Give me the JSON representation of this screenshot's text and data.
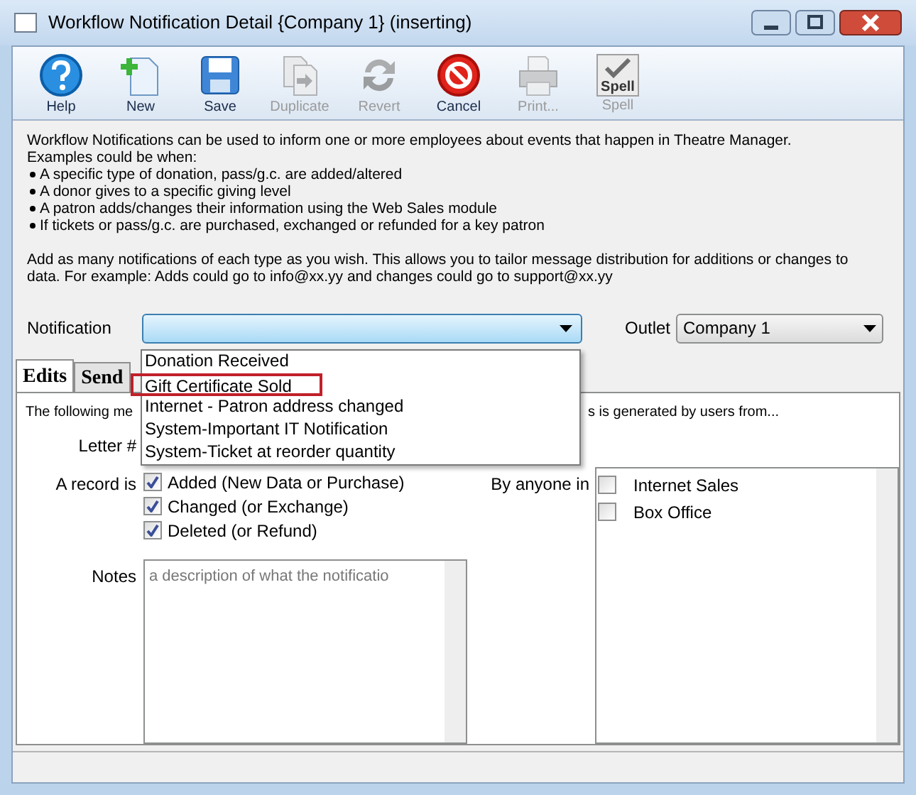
{
  "window": {
    "title": "Workflow Notification Detail {Company 1} (inserting)"
  },
  "toolbar": [
    {
      "label": "Help",
      "kind": "help",
      "disabled": false
    },
    {
      "label": "New",
      "kind": "new",
      "disabled": false
    },
    {
      "label": "Save",
      "kind": "save",
      "disabled": false
    },
    {
      "label": "Duplicate",
      "kind": "duplicate",
      "disabled": true
    },
    {
      "label": "Revert",
      "kind": "revert",
      "disabled": true
    },
    {
      "label": "Cancel",
      "kind": "cancel",
      "disabled": false
    },
    {
      "label": "Print...",
      "kind": "print",
      "disabled": true
    },
    {
      "label": "Spell",
      "kind": "spell",
      "disabled": true,
      "icon_text": "Spell"
    }
  ],
  "info": {
    "intro": [
      "Workflow Notifications can be used to inform one or more employees about events that happen in Theatre Manager.",
      "Examples could be when:"
    ],
    "bullets": [
      "A specific type of donation, pass/g.c. are added/altered",
      "A donor gives to a specific giving level",
      "A patron adds/changes their information using the Web Sales module",
      "If tickets or pass/g.c. are purchased, exchanged or refunded for a key patron"
    ],
    "outro": "Add as many notifications of each type as you wish.  This allows you to tailor message distribution for additions or changes to data.  For example: Adds could go to info@xx.yy and changes could go to support@xx.yy"
  },
  "notification": {
    "label": "Notification",
    "expanded": true,
    "options": [
      {
        "label": "Donation Received",
        "highlighted": false
      },
      {
        "label": "Gift Certificate Sold",
        "highlighted": true
      },
      {
        "label": "Internet - Patron address changed",
        "highlighted": false
      },
      {
        "label": "System-Important IT Notification",
        "highlighted": false
      },
      {
        "label": "System-Ticket at reorder quantity",
        "highlighted": false
      }
    ]
  },
  "outlet": {
    "label": "Outlet",
    "value": "Company 1"
  },
  "tabs": [
    {
      "label": "Edits",
      "selected": true
    },
    {
      "label": "Send",
      "selected": false
    }
  ],
  "panel": {
    "description_left": "The following me",
    "description_right": "s is generated by users from...",
    "letter_label": "Letter #",
    "record_label": "A record is",
    "record_options": [
      {
        "label": "Added (New Data or Purchase)",
        "checked": true
      },
      {
        "label": "Changed (or Exchange)",
        "checked": true
      },
      {
        "label": "Deleted (or Refund)",
        "checked": true
      }
    ],
    "anyone_label": "By anyone in",
    "anyone_options": [
      {
        "label": "Internet Sales",
        "checked": false
      },
      {
        "label": "Box Office",
        "checked": false
      }
    ],
    "notes_label": "Notes",
    "notes_placeholder": "a description of what the notificatio"
  }
}
